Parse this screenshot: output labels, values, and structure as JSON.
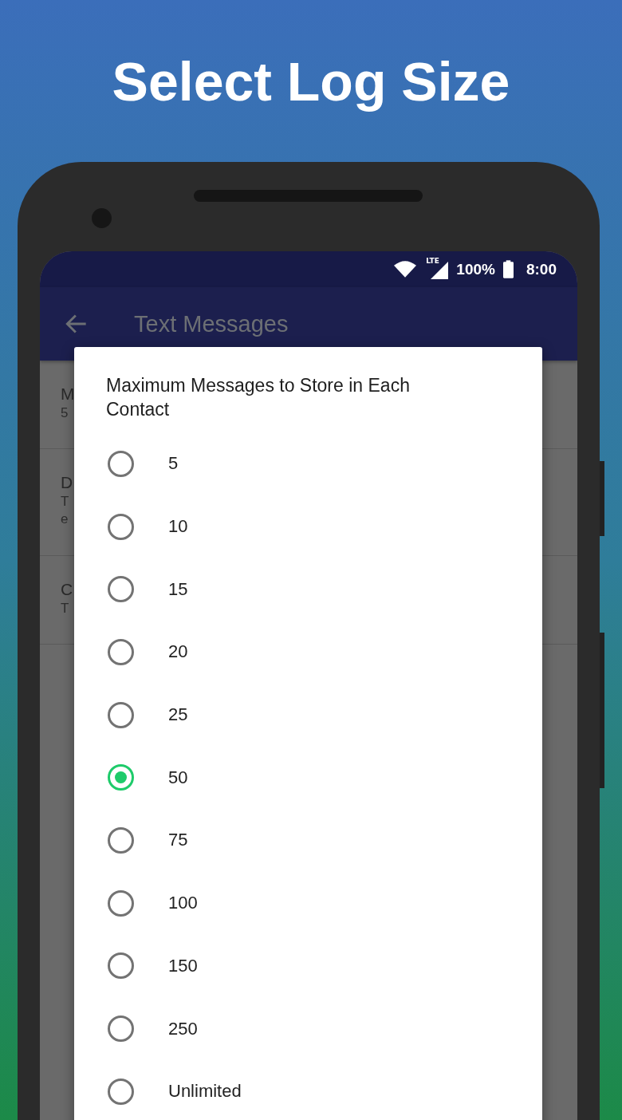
{
  "headline": "Select Log Size",
  "status_bar": {
    "network": "LTE",
    "battery": "100%",
    "time": "8:00"
  },
  "app_bar": {
    "title": "Text Messages"
  },
  "background_list": [
    {
      "title": "M",
      "subtitle": [
        "5"
      ]
    },
    {
      "title": "D",
      "subtitle": [
        "T",
        "e"
      ]
    },
    {
      "title": "C",
      "subtitle": [
        "T"
      ]
    }
  ],
  "dialog": {
    "title": "Maximum Messages to Store in Each Contact",
    "options": [
      {
        "label": "5",
        "selected": false
      },
      {
        "label": "10",
        "selected": false
      },
      {
        "label": "15",
        "selected": false
      },
      {
        "label": "20",
        "selected": false
      },
      {
        "label": "25",
        "selected": false
      },
      {
        "label": "50",
        "selected": true
      },
      {
        "label": "75",
        "selected": false
      },
      {
        "label": "100",
        "selected": false
      },
      {
        "label": "150",
        "selected": false
      },
      {
        "label": "250",
        "selected": false
      },
      {
        "label": "Unlimited",
        "selected": false
      }
    ]
  }
}
